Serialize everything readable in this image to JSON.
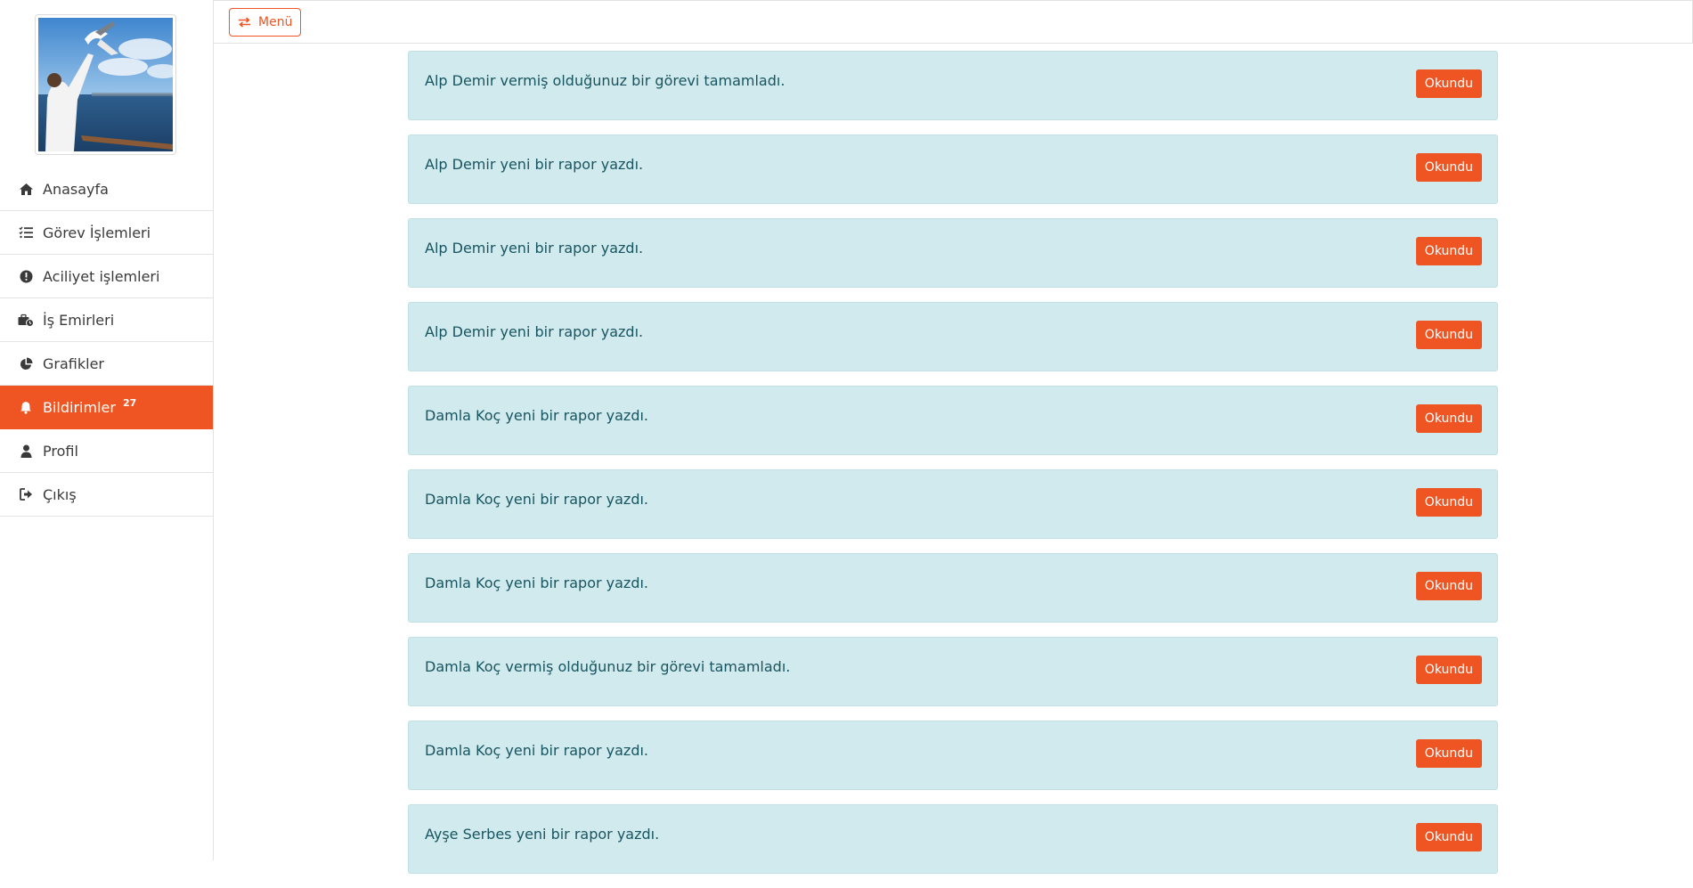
{
  "sidebar": {
    "avatar_alt": "Profil fotoğrafı",
    "items": [
      {
        "label": "Anasayfa",
        "icon": "home-icon"
      },
      {
        "label": "Görev İşlemleri",
        "icon": "list-check-icon"
      },
      {
        "label": "Aciliyet işlemleri",
        "icon": "exclamation-circle-icon"
      },
      {
        "label": "İş Emirleri",
        "icon": "briefcase-clock-icon"
      },
      {
        "label": "Grafikler",
        "icon": "pie-chart-icon"
      },
      {
        "label": "Bildirimler",
        "icon": "bell-icon",
        "badge": "27",
        "active": true
      },
      {
        "label": "Profil",
        "icon": "user-icon"
      },
      {
        "label": "Çıkış",
        "icon": "sign-out-icon"
      }
    ]
  },
  "topbar": {
    "menu_label": "Menü"
  },
  "notifications": [
    {
      "text": "Alp Demir vermiş olduğunuz bir görevi tamamladı.",
      "button": "Okundu"
    },
    {
      "text": "Alp Demir yeni bir rapor yazdı.",
      "button": "Okundu"
    },
    {
      "text": "Alp Demir yeni bir rapor yazdı.",
      "button": "Okundu"
    },
    {
      "text": "Alp Demir yeni bir rapor yazdı.",
      "button": "Okundu"
    },
    {
      "text": "Damla Koç yeni bir rapor yazdı.",
      "button": "Okundu"
    },
    {
      "text": "Damla Koç yeni bir rapor yazdı.",
      "button": "Okundu"
    },
    {
      "text": "Damla Koç yeni bir rapor yazdı.",
      "button": "Okundu"
    },
    {
      "text": "Damla Koç vermiş olduğunuz bir görevi tamamladı.",
      "button": "Okundu"
    },
    {
      "text": "Damla Koç yeni bir rapor yazdı.",
      "button": "Okundu"
    },
    {
      "text": "Ayşe Serbes yeni bir rapor yazdı.",
      "button": "Okundu"
    }
  ],
  "colors": {
    "accent": "#ee5523",
    "alert_bg": "#d1eaee",
    "alert_text": "#175560"
  }
}
